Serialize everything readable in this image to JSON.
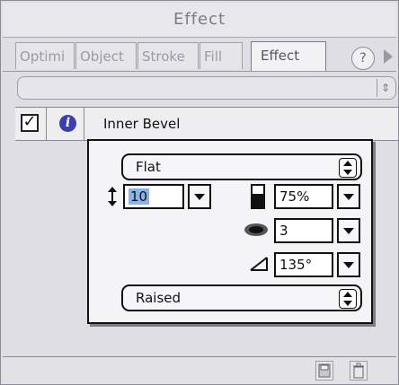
{
  "window": {
    "title": "Effect"
  },
  "tabs": [
    {
      "label": "Optimi"
    },
    {
      "label": "Object"
    },
    {
      "label": "Stroke"
    },
    {
      "label": "Fill"
    },
    {
      "label": "Effect"
    }
  ],
  "help_label": "?",
  "effect": {
    "name": "Inner Bevel",
    "enabled": true
  },
  "bevel": {
    "shape": "Flat",
    "width": "10",
    "contrast": "75%",
    "softness": "3",
    "angle": "135°",
    "preset": "Raised"
  },
  "icons": {
    "help": "help-icon",
    "scroll_right": "chevron-right-icon",
    "info": "info-icon",
    "width": "vertical-arrows-icon",
    "contrast": "contrast-icon",
    "softness": "blur-icon",
    "angle": "angle-icon",
    "save": "save-icon",
    "trash": "trash-icon"
  },
  "colors": {
    "selection": "#88b4e8",
    "info_icon": "#3a3fb0"
  }
}
